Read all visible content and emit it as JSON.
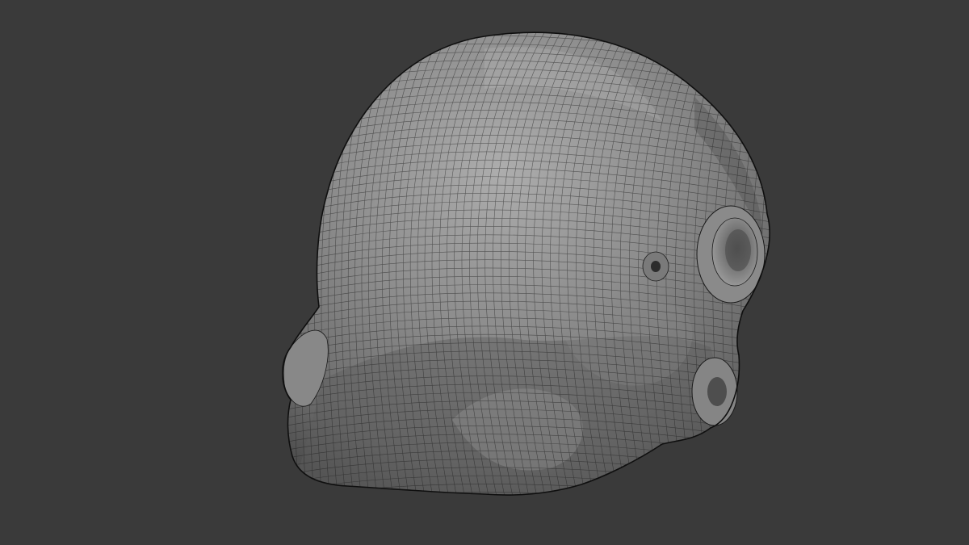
{
  "viewport": {
    "background_color": "#3a3a3a",
    "mesh_fill_color": "#7f7f7f",
    "mesh_highlight_color": "#a6a6a6",
    "mesh_shadow_color": "#4a4a4a",
    "wire_color": "#1a1a1a",
    "outline_color": "#0f0f0f",
    "icon": "sculpt-mesh-wireframe"
  }
}
